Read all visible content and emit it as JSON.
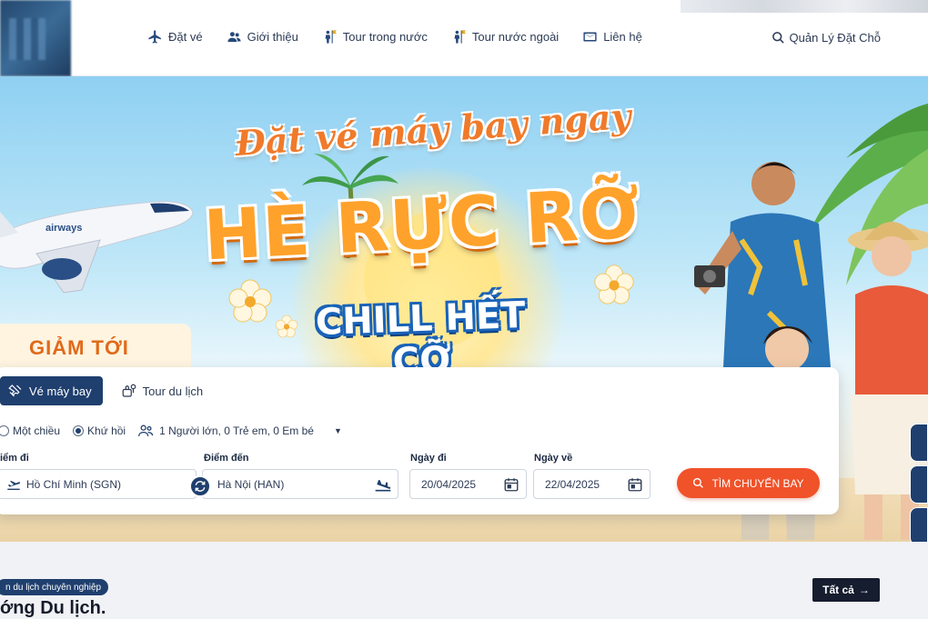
{
  "header": {
    "nav": [
      {
        "label": "Đặt vé",
        "icon": "airplane-icon"
      },
      {
        "label": "Giới thiệu",
        "icon": "people-icon"
      },
      {
        "label": "Tour trong nước",
        "icon": "person-flag-icon"
      },
      {
        "label": "Tour nước ngoài",
        "icon": "person-flag-icon"
      },
      {
        "label": "Liên hệ",
        "icon": "mail-icon"
      }
    ],
    "manage_booking": "Quản Lý Đặt Chỗ"
  },
  "banner": {
    "headline_top": "Đặt vé máy bay ngay",
    "headline_main": "HÈ RỰC RỠ",
    "headline_sub": "CHILL HẾT CỠ",
    "discount_label": "GIẢM TỚI"
  },
  "search": {
    "tabs": [
      {
        "label": "Vé máy bay",
        "active": true,
        "icon": "plane-ticket-icon"
      },
      {
        "label": "Tour du lịch",
        "active": false,
        "icon": "tour-icon"
      }
    ],
    "trip_types": [
      {
        "label": "Một chiều",
        "checked": false
      },
      {
        "label": "Khứ hồi",
        "checked": true
      }
    ],
    "passengers": "1 Người lớn, 0 Trẻ em, 0 Em bé",
    "from_label": "iểm đi",
    "from_value": "Hồ Chí Minh (SGN)",
    "to_label": "Điểm đến",
    "to_value": "Hà Nội (HAN)",
    "depart_label": "Ngày đi",
    "depart_value": "20/04/2025",
    "return_label": "Ngày về",
    "return_value": "22/04/2025",
    "search_button": "TÌM CHUYẾN BAY"
  },
  "section": {
    "badge": "n du lịch chuyên nghiệp",
    "title": "ớng Du lịch.",
    "see_all": "Tất cả"
  },
  "colors": {
    "navy": "#1f3f6e",
    "accent_orange": "#f0522a",
    "headline_orange": "#ffa22b",
    "sky": "#8fd0f2"
  }
}
